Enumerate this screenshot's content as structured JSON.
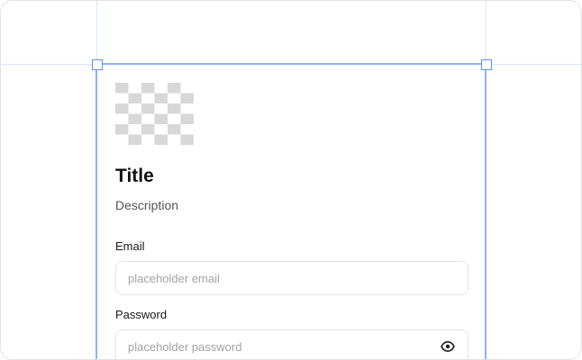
{
  "card": {
    "image_icon": "image-placeholder-checker",
    "title": "Title",
    "description": "Description"
  },
  "form": {
    "email_label": "Email",
    "email_placeholder": "placeholder email",
    "password_label": "Password",
    "password_placeholder": "placeholder password",
    "password_toggle_icon": "eye-icon"
  },
  "colors": {
    "selection": "#8db4f3",
    "guide": "#d9e4fb",
    "checker": "#d8d8d8"
  }
}
